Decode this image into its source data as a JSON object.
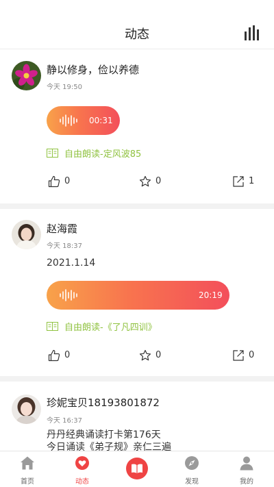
{
  "header": {
    "title": "动态",
    "stats_icon": "bar-chart-icon"
  },
  "posts": [
    {
      "username": "静以修身，俭以养德",
      "time": "今天 19:50",
      "text": "",
      "audio_duration": "00:31",
      "reading": "自由朗读-定风波85",
      "likes": "0",
      "favorites": "0",
      "shares": "1"
    },
    {
      "username": "赵海霞",
      "time": "今天 18:37",
      "text": "2021.1.14",
      "audio_duration": "20:19",
      "reading": "自由朗读-《了凡四训》",
      "likes": "0",
      "favorites": "0",
      "shares": "0"
    },
    {
      "username": "珍妮宝贝18193801872",
      "time": "今天 16:37",
      "text_line1": "丹丹经典诵读打卡第176天",
      "text_line2": "今日诵读《弟子规》亲仁三遍"
    }
  ],
  "tabs": [
    {
      "label": "首页",
      "icon": "home-icon",
      "active": false
    },
    {
      "label": "动态",
      "icon": "heart-chat-icon",
      "active": true
    },
    {
      "label": "",
      "icon": "book-open-icon",
      "active": false
    },
    {
      "label": "发现",
      "icon": "compass-icon",
      "active": false
    },
    {
      "label": "我的",
      "icon": "person-icon",
      "active": false
    }
  ],
  "colors": {
    "accent": "#ef4444",
    "reading_green": "#8fc23f",
    "gradient_start": "#f8a24a",
    "gradient_end": "#f34f5b"
  }
}
